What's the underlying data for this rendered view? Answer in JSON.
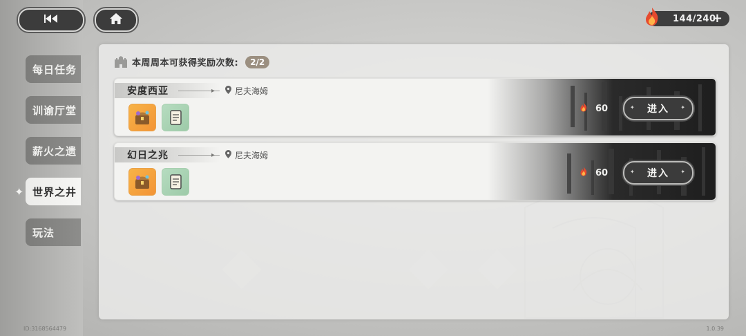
{
  "topbar": {
    "back_icon": "double-left-arrow-icon",
    "home_icon": "home-icon",
    "stamina": {
      "icon": "flame-icon",
      "value": "144/240",
      "add_label": "+"
    }
  },
  "sidebar": {
    "items": [
      {
        "label": "每日任务",
        "active": false
      },
      {
        "label": "训谕厅堂",
        "active": false
      },
      {
        "label": "薪火之遗",
        "active": false
      },
      {
        "label": "世界之井",
        "active": true
      },
      {
        "label": "玩法",
        "active": false
      }
    ]
  },
  "main": {
    "header": {
      "label": "本周周本可获得奖励次数:",
      "count": "2/2"
    },
    "stages": [
      {
        "title": "安度西亚",
        "location": "尼夫海姆",
        "rewards": [
          "reward-chest-icon",
          "reward-scroll-icon"
        ],
        "cost": "60",
        "enter_label": "进入"
      },
      {
        "title": "幻日之兆",
        "location": "尼夫海姆",
        "rewards": [
          "reward-chest-icon",
          "reward-scroll-icon"
        ],
        "cost": "60",
        "enter_label": "进入"
      }
    ]
  },
  "footer": {
    "id": "ID:3168564479",
    "version": "1.0.39"
  },
  "colors": {
    "accent_dark": "#3c3c3c",
    "badge": "#9b8f80",
    "flame": "#e64a2e"
  }
}
